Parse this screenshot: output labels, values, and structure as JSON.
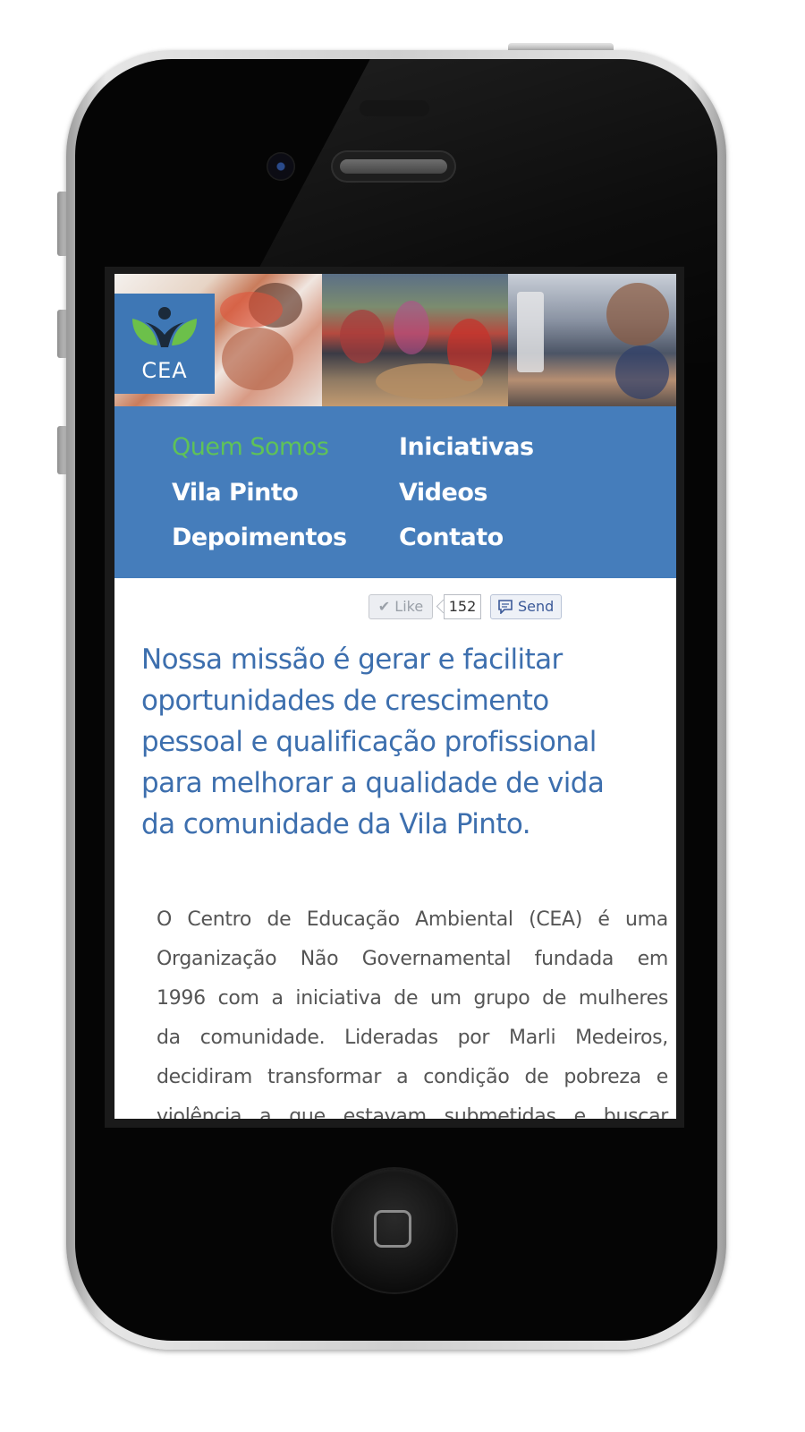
{
  "site": {
    "logo_text": "CEA"
  },
  "nav": {
    "items": [
      {
        "label": "Quem Somos",
        "active": true
      },
      {
        "label": "Iniciativas",
        "active": false
      },
      {
        "label": "Vila Pinto",
        "active": false
      },
      {
        "label": "Videos",
        "active": false
      },
      {
        "label": "Depoimentos",
        "active": false
      },
      {
        "label": "Contato",
        "active": false
      }
    ]
  },
  "social": {
    "like_label": "Like",
    "like_count": "152",
    "send_label": "Send"
  },
  "mission": {
    "lines": [
      "Nossa missão é gerar e facilitar",
      "oportunidades de crescimento",
      "pessoal e qualificação profissional",
      "para melhorar a qualidade de vida",
      "da comunidade da Vila Pinto."
    ]
  },
  "about": {
    "lines": [
      "O Centro de Educação Ambiental (CEA) é uma",
      "Organização Não Governamental fundada em",
      "1996 com a iniciativa de um grupo de mulheres",
      "da comunidade. Lideradas por Marli Medeiros,",
      "decidiram transformar a condição de pobreza e",
      "violência a que estavam submetidas e buscar"
    ]
  },
  "colors": {
    "brand_blue": "#457dbb",
    "logo_blue": "#3e77b5",
    "active_green": "#5fc258",
    "mission_blue": "#3d6fae",
    "body_gray": "#555555"
  },
  "icons": {
    "like": "check-icon",
    "send": "speech-bubble-icon",
    "home": "home-button-square"
  }
}
